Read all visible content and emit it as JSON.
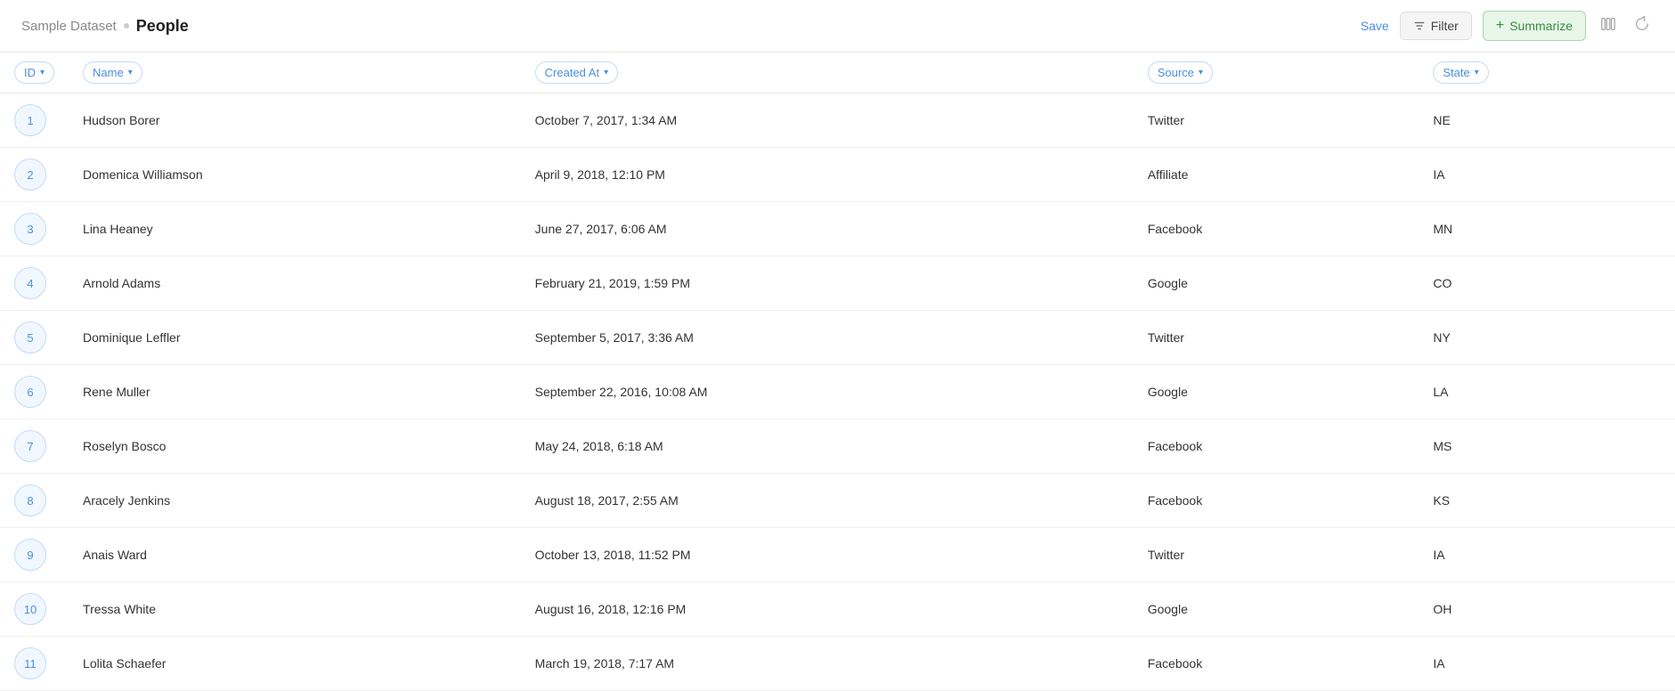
{
  "header": {
    "dataset": "Sample Dataset",
    "title": "People",
    "save_label": "Save",
    "filter_label": "Filter",
    "summarize_label": "Summarize"
  },
  "columns": [
    {
      "id": "col-id",
      "label": "ID"
    },
    {
      "id": "col-name",
      "label": "Name"
    },
    {
      "id": "col-created-at",
      "label": "Created At"
    },
    {
      "id": "col-source",
      "label": "Source"
    },
    {
      "id": "col-state",
      "label": "State"
    }
  ],
  "rows": [
    {
      "id": 1,
      "name": "Hudson Borer",
      "created_at": "October 7, 2017, 1:34 AM",
      "source": "Twitter",
      "state": "NE"
    },
    {
      "id": 2,
      "name": "Domenica Williamson",
      "created_at": "April 9, 2018, 12:10 PM",
      "source": "Affiliate",
      "state": "IA"
    },
    {
      "id": 3,
      "name": "Lina Heaney",
      "created_at": "June 27, 2017, 6:06 AM",
      "source": "Facebook",
      "state": "MN"
    },
    {
      "id": 4,
      "name": "Arnold Adams",
      "created_at": "February 21, 2019, 1:59 PM",
      "source": "Google",
      "state": "CO"
    },
    {
      "id": 5,
      "name": "Dominique Leffler",
      "created_at": "September 5, 2017, 3:36 AM",
      "source": "Twitter",
      "state": "NY"
    },
    {
      "id": 6,
      "name": "Rene Muller",
      "created_at": "September 22, 2016, 10:08 AM",
      "source": "Google",
      "state": "LA"
    },
    {
      "id": 7,
      "name": "Roselyn Bosco",
      "created_at": "May 24, 2018, 6:18 AM",
      "source": "Facebook",
      "state": "MS"
    },
    {
      "id": 8,
      "name": "Aracely Jenkins",
      "created_at": "August 18, 2017, 2:55 AM",
      "source": "Facebook",
      "state": "KS"
    },
    {
      "id": 9,
      "name": "Anais Ward",
      "created_at": "October 13, 2018, 11:52 PM",
      "source": "Twitter",
      "state": "IA"
    },
    {
      "id": 10,
      "name": "Tressa White",
      "created_at": "August 16, 2018, 12:16 PM",
      "source": "Google",
      "state": "OH"
    },
    {
      "id": 11,
      "name": "Lolita Schaefer",
      "created_at": "March 19, 2018, 7:17 AM",
      "source": "Facebook",
      "state": "IA"
    }
  ]
}
